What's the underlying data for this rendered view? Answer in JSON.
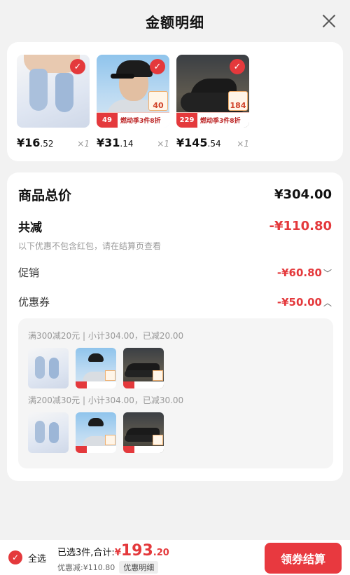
{
  "header": {
    "title": "金额明细"
  },
  "products": [
    {
      "price_int": "¥16",
      "price_dec": ".52",
      "qty": "×1"
    },
    {
      "price_int": "¥31",
      "price_dec": ".14",
      "qty": "×1",
      "tag_num": "49",
      "tag_text": "燃动季3件8折",
      "side": "40"
    },
    {
      "price_int": "¥145",
      "price_dec": ".54",
      "qty": "×1",
      "tag_num": "229",
      "tag_text": "燃动季3件8折",
      "side": "184"
    }
  ],
  "summary": {
    "total_label": "商品总价",
    "total_value": "¥304.00",
    "discount_label": "共减",
    "discount_value": "-¥110.80",
    "note": "以下优惠不包含红包，请在结算页查看",
    "promo_label": "促销",
    "promo_value": "-¥60.80",
    "coupon_label": "优惠券",
    "coupon_value": "-¥50.00",
    "coupon_line_1": "满300减20元 | 小计304.00，已减20.00",
    "coupon_line_2": "满200减30元 | 小计304.00，已减30.00"
  },
  "footer": {
    "select_all": "全选",
    "selected_text": "已选3件,合计:",
    "currency": "¥",
    "total_int": "193",
    "total_dec": ".20",
    "saved_text": "优惠减:¥110.80",
    "detail_button": "优惠明细",
    "checkout_button": "领券结算"
  },
  "colors": {
    "accent": "#e4393c"
  }
}
